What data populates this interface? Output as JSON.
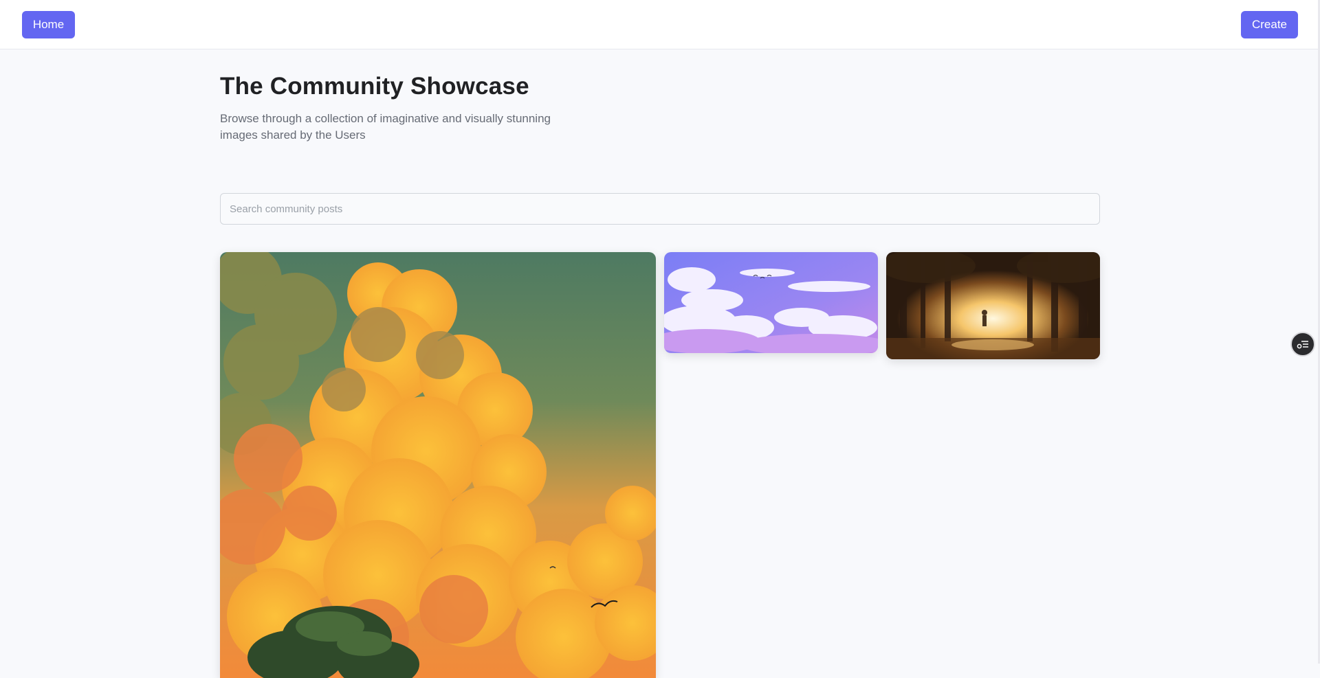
{
  "nav": {
    "home_label": "Home",
    "create_label": "Create"
  },
  "header": {
    "title": "The Community Showcase",
    "subtitle": "Browse through a collection of imaginative and visually stunning images shared by the Users"
  },
  "search": {
    "placeholder": "Search community posts",
    "value": ""
  },
  "gallery": {
    "items": [
      {
        "icon": "sunset-clouds-tree-image"
      },
      {
        "icon": "purple-sky-clouds-image"
      },
      {
        "icon": "sunlit-forest-figure-image"
      }
    ]
  },
  "floating_button": {
    "icon": "toggle-list-icon"
  },
  "colors": {
    "accent": "#6366f1",
    "background": "#f8f9fc",
    "title": "#202124",
    "subtitle": "#666b75"
  }
}
